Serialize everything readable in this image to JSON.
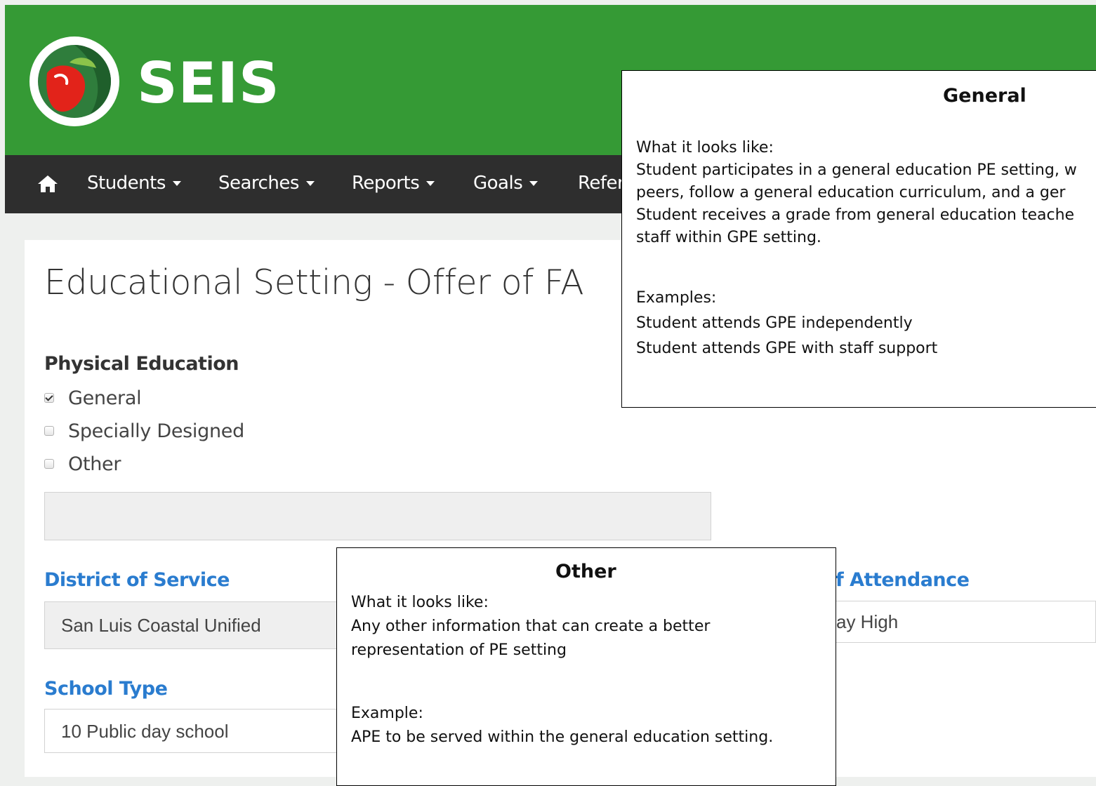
{
  "app": {
    "brand": "SEIS"
  },
  "nav": {
    "home_icon": "home-icon",
    "items": [
      {
        "label": "Students"
      },
      {
        "label": "Searches"
      },
      {
        "label": "Reports"
      },
      {
        "label": "Goals"
      },
      {
        "label": "Refer"
      }
    ]
  },
  "page": {
    "title": "Educational Setting - Offer of FA"
  },
  "physical_education": {
    "label": "Physical Education",
    "options": [
      {
        "label": "General",
        "checked": true
      },
      {
        "label": "Specially Designed",
        "checked": false
      },
      {
        "label": "Other",
        "checked": false
      }
    ],
    "other_text": ""
  },
  "district_of_service": {
    "label": "District of Service",
    "value": "San Luis Coastal Unified"
  },
  "school_of_attendance": {
    "label": "f Attendance",
    "value": "ay High"
  },
  "school_type": {
    "label": "School Type",
    "value": "10 Public day school"
  },
  "tooltip_general": {
    "title": "General",
    "lines": [
      "What it looks like:",
      "Student participates in a general education PE setting, w",
      "peers, follow a general education curriculum, and a ger",
      "Student receives a grade from general education teache",
      "staff within GPE setting.",
      "",
      "Examples:",
      "Student attends GPE independently",
      "Student attends GPE with staff support"
    ]
  },
  "tooltip_other": {
    "title": "Other",
    "lines": [
      "What it looks like:",
      "Any other information that can create a better",
      "representation of PE setting",
      "",
      "Example:",
      "APE to be served within the general education setting."
    ]
  },
  "colors": {
    "header_green": "#359a35",
    "navbar": "#2e2e2e",
    "link_blue": "#2a7ccf"
  }
}
